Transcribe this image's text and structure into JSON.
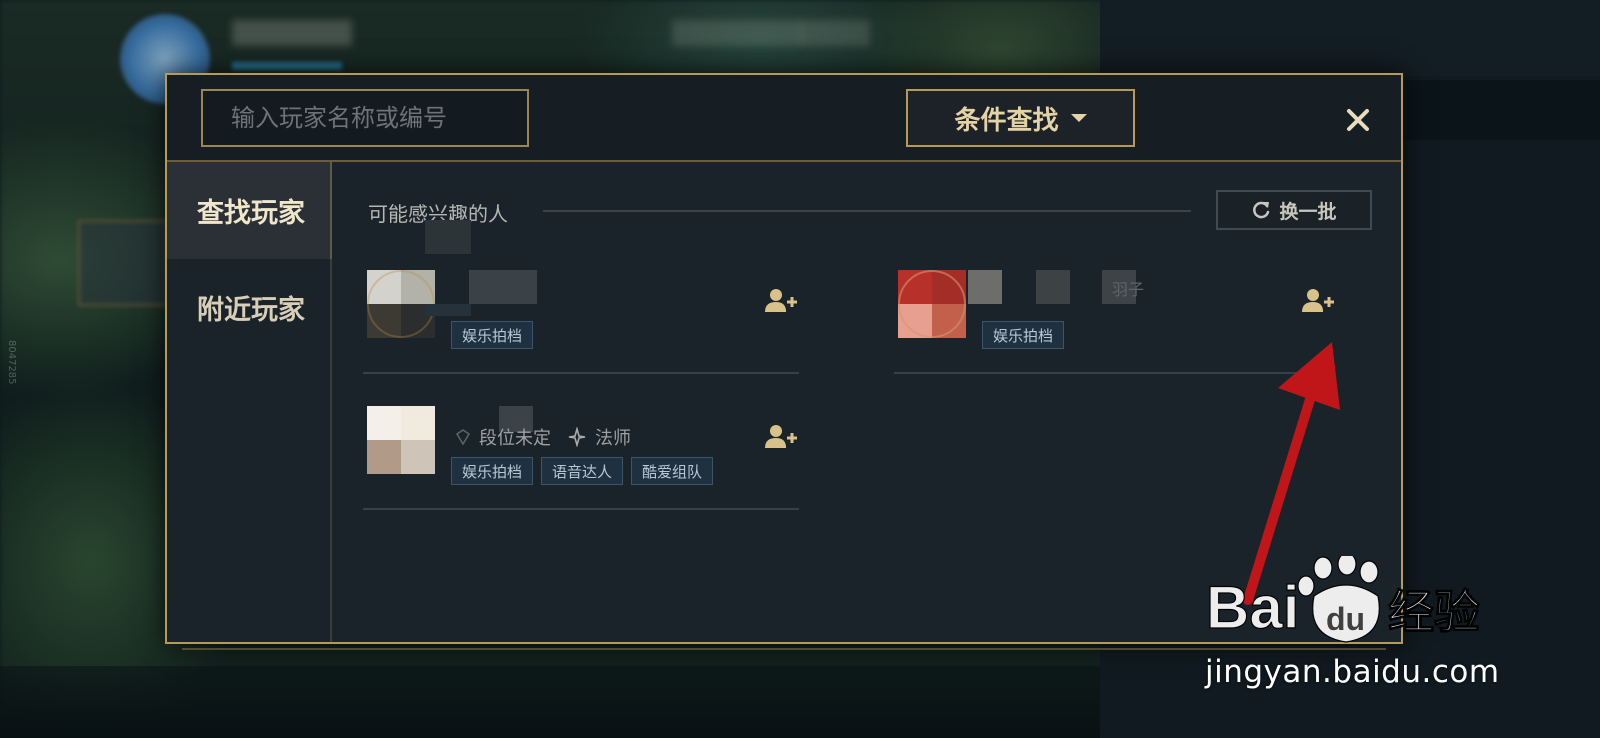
{
  "search": {
    "placeholder": "输入玩家名称或编号",
    "value": ""
  },
  "filter_button": {
    "label": "条件查找"
  },
  "sidebar": {
    "items": [
      {
        "label": "查找玩家",
        "active": true
      },
      {
        "label": "附近玩家",
        "active": false
      }
    ]
  },
  "section": {
    "title": "可能感兴趣的人",
    "refresh_label": "换一批"
  },
  "players": [
    {
      "tags": [
        "娱乐拍档"
      ]
    },
    {
      "name_fragment": "羽子",
      "tags": [
        "娱乐拍档"
      ]
    },
    {
      "rank": "段位未定",
      "role": "法师",
      "tags": [
        "娱乐拍档",
        "语音达人",
        "酷爱组队"
      ]
    }
  ],
  "background": {
    "side_id": "8047285"
  },
  "watermark": {
    "url": "jingyan.baidu.com"
  },
  "colors": {
    "accent_gold": "#b79a55",
    "dialog_bg": "#1a232a",
    "tag_bg": "#1f3140",
    "annotation_red": "#c0161a"
  },
  "icons": {
    "search": "search-icon",
    "close": "close-icon",
    "refresh": "refresh-icon",
    "add_friend": "add-friend-icon",
    "mage": "mage-role-icon"
  }
}
